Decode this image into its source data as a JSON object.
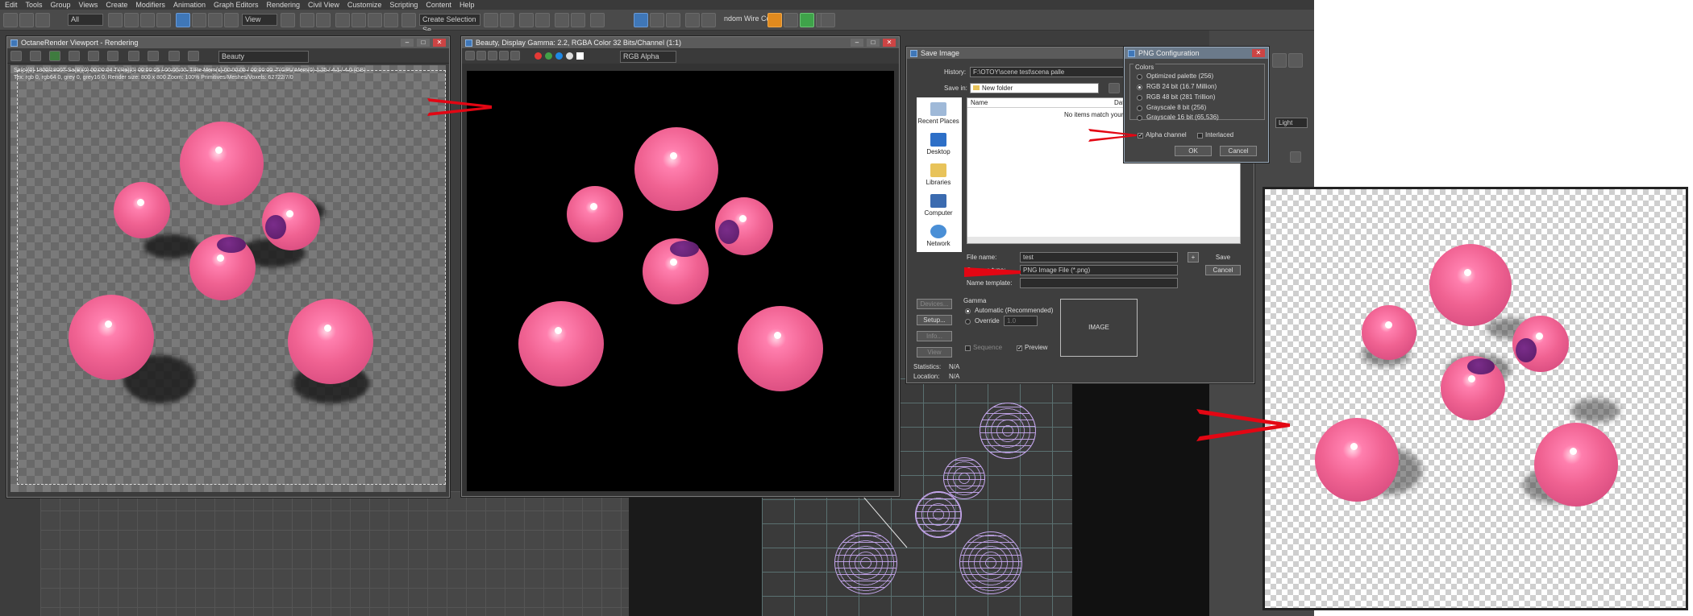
{
  "menu": [
    "Edit",
    "Tools",
    "Group",
    "Views",
    "Create",
    "Modifiers",
    "Animation",
    "Graph Editors",
    "Rendering",
    "Civil View",
    "Customize",
    "Scripting",
    "Content",
    "Help"
  ],
  "toolbar": {
    "filter_value": "All",
    "view_value": "View",
    "selection_set": "Create Selection Se",
    "wire_tag": "ndom Wire Col"
  },
  "octane": {
    "title": "OctaneRender Viewport - Rendering",
    "channel": "Beauty",
    "info_line1": "Sa(p)(0) 1800/1800T   Sa(B)(0) 00:00:04  Ti(Re)(0) 00:00:05 / 00:00:00.  T/Re Mem(s) 00:00:05 / 00:00:00.  T(GPU)Mem(0) 1.25 / 4.1 / 4.0 (GB)",
    "info_line2": "Tex: rgb 0, rgb64 0, grey 0, grey16 0.    Render size: 800 x 800    Zoom: 100%    Primitives/Meshes/Voxels: 62722/7/0"
  },
  "frame_buffer": {
    "title": "Beauty, Display Gamma: 2.2, RGBA Color 32 Bits/Channel (1:1)",
    "channel": "RGB Alpha"
  },
  "save_dialog": {
    "title": "Save Image",
    "history_label": "History:",
    "history_value": "F:\\OTOY\\scene test\\scena palle",
    "save_in_label": "Save in:",
    "save_in_value": "New folder",
    "col_name": "Name",
    "col_date": "Dat",
    "empty_text": "No items match your",
    "places": [
      "Recent Places",
      "Desktop",
      "Libraries",
      "Computer",
      "Network"
    ],
    "file_name_label": "File name:",
    "file_name_value": "test",
    "save_as_label": "Save as type:",
    "save_as_value": "PNG Image File (*.png)",
    "name_template_label": "Name template:",
    "save_btn": "Save",
    "cancel_btn": "Cancel",
    "plus_btn": "+",
    "devices_btn": "Devices...",
    "setup_btn": "Setup...",
    "info_btn": "Info...",
    "view_btn": "View",
    "gamma_label": "Gamma",
    "gamma_auto": "Automatic (Recommended)",
    "gamma_override": "Override",
    "gamma_override_value": "1.0",
    "image_label": "IMAGE",
    "sequence_label": "Sequence",
    "preview_label": "Preview",
    "stats_label": "Statistics:",
    "stats_value": "N/A",
    "location_label": "Location:",
    "location_value": "N/A"
  },
  "png_dialog": {
    "title": "PNG Configuration",
    "group_label": "Colors",
    "options": [
      "Optimized palette  (256)",
      "RGB 24 bit  (16.7 Million)",
      "RGB 48 bit  (281 Trillion)",
      "Grayscale 8 bit  (256)",
      "Grayscale 16 bit  (65,536)"
    ],
    "selected_index": 1,
    "alpha_label": "Alpha channel",
    "alpha_checked": true,
    "interlaced_label": "Interlaced",
    "interlaced_checked": false,
    "ok_btn": "OK",
    "cancel_btn": "Cancel"
  },
  "cmd_panel": {
    "light_label": "Light"
  },
  "colors": {
    "sphere_pink": "#f06292",
    "arrow_red": "#e30613",
    "max_bg": "#444444",
    "wire_purple": "#c7a8f0"
  }
}
